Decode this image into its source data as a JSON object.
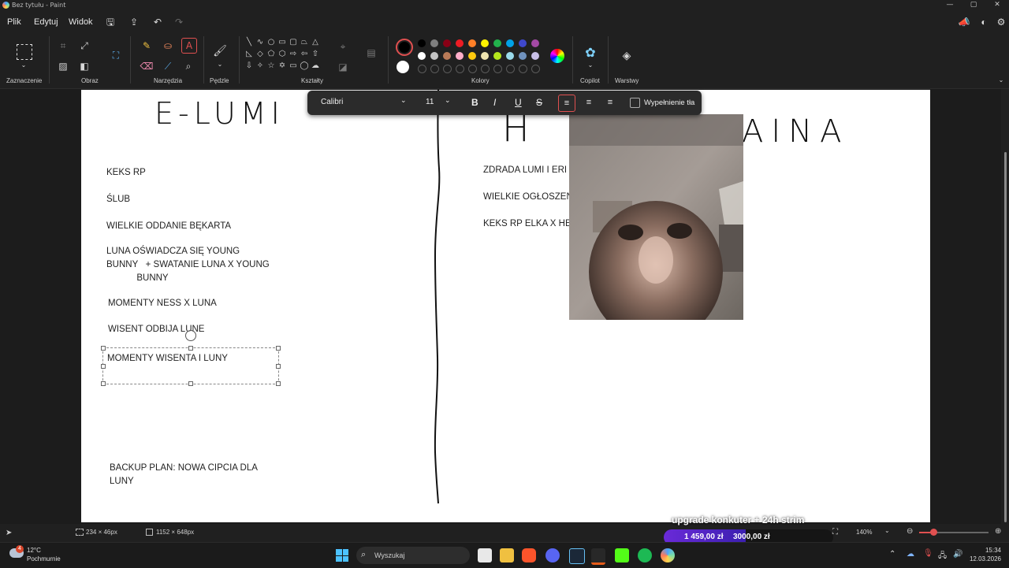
{
  "window": {
    "title": "Bez tytułu - Paint"
  },
  "menu": {
    "file": "Plik",
    "edit": "Edytuj",
    "view": "Widok"
  },
  "ribbon": {
    "groups": {
      "selection": "Zaznaczenie",
      "image": "Obraz",
      "tools": "Narzędzia",
      "brushes": "Pędzle",
      "shapes": "Kształty",
      "colors": "Kolory",
      "copilot": "Copilot",
      "layers": "Warstwy"
    },
    "palette_row1": [
      "#000000",
      "#7f7f7f",
      "#880015",
      "#ed1c24",
      "#ff7f27",
      "#fff200",
      "#22b14c",
      "#00a2e8",
      "#3f48cc",
      "#a349a4"
    ],
    "palette_row2": [
      "#ffffff",
      "#c3c3c3",
      "#b97a57",
      "#ffaec9",
      "#ffc90e",
      "#efe4b0",
      "#b5e61d",
      "#99d9ea",
      "#7092be",
      "#c8bfe7"
    ],
    "primary_color": "#000000",
    "secondary_color": "#ffffff"
  },
  "text_toolbar": {
    "font": "Calibri",
    "size": "11",
    "bold": "B",
    "italic": "I",
    "underline": "U",
    "strike": "S",
    "fill_label": "Wypełnienie tła"
  },
  "canvas": {
    "left_heading": "E-LUMI",
    "right_heading_start": "H",
    "right_heading_end": "AINA",
    "left_items": [
      "KEKS RP",
      "ŚLUB",
      "WIELKIE ODDANIE BĘKARTA",
      "LUNA OŚWIADCZA SIĘ YOUNG\nBUNNY   + SWATANIE LUNA X YOUNG\n            BUNNY",
      "MOMENTY NESS X LUNA",
      "WISENT ODBIJA LUNE",
      "MOMENTY WISENTA I LUNY",
      "BACKUP PLAN: NOWA CIPCIA DLA\nLUNY"
    ],
    "right_items": [
      "ZDRADA LUMI I ERI",
      "WIELKIE OGŁOSZEN",
      "KEKS RP ELKA X HEI"
    ]
  },
  "status": {
    "selection_size": "234 × 46px",
    "canvas_size": "1152 × 648px",
    "zoom": "140%"
  },
  "overlay": {
    "goal_title": "upgrade konkuter + 24h strim",
    "goal_current": "1 459,00 zł",
    "goal_target": "3000,00 zł",
    "goal_progress": 0.486
  },
  "taskbar": {
    "weather_temp": "12°C",
    "weather_desc": "Pochmurnie",
    "search_placeholder": "Wyszukaj",
    "time": "15:34",
    "date": "12.03.2026",
    "badge_count": "4"
  }
}
